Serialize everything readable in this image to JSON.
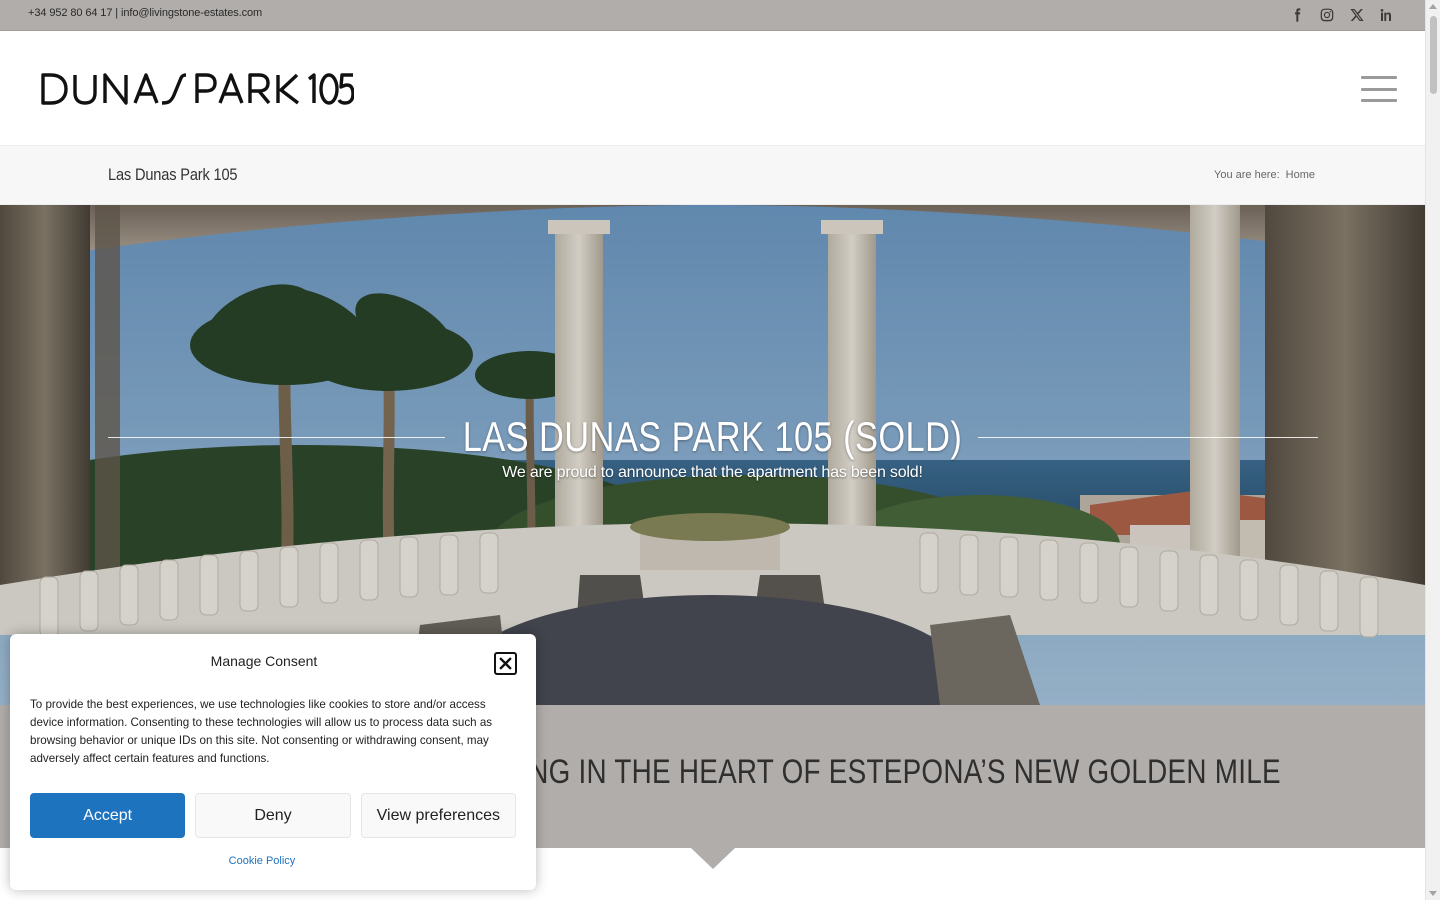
{
  "topbar": {
    "contact": "+34 952 80 64 17 | info@livingstone-estates.com",
    "social_icons": [
      "facebook-icon",
      "instagram-icon",
      "x-icon",
      "linkedin-icon"
    ]
  },
  "header": {
    "logo_text": "DUNAS PARK 105",
    "menu_icon": "hamburger-menu-icon"
  },
  "titlebar": {
    "page_title": "Las Dunas Park 105",
    "breadcrumb_prefix": "You are here:",
    "breadcrumb_home": "Home"
  },
  "hero": {
    "title": "LAS DUNAS PARK 105 (SOLD)",
    "subtitle": "We are proud to announce that the apartment has been sold!"
  },
  "section": {
    "title": "FRONTLINE BEACH LIVING IN THE HEART OF ESTEPONA’S NEW GOLDEN MILE",
    "visible_title": "RONT LIVING IN THE HEART OF ESTEPONA’S NEW GOLDEN MILE"
  },
  "consent": {
    "title": "Manage Consent",
    "body": "To provide the best experiences, we use technologies like cookies to store and/or access device information. Consenting to these technologies will allow us to process data such as browsing behavior or unique IDs on this site. Not consenting or withdrawing consent, may adversely affect certain features and functions.",
    "accept_label": "Accept",
    "deny_label": "Deny",
    "preferences_label": "View preferences",
    "policy_label": "Cookie Policy"
  },
  "colors": {
    "topbar_bg": "#b1adaa",
    "band_bg": "#b1adaa",
    "accent_blue": "#1e73be"
  }
}
